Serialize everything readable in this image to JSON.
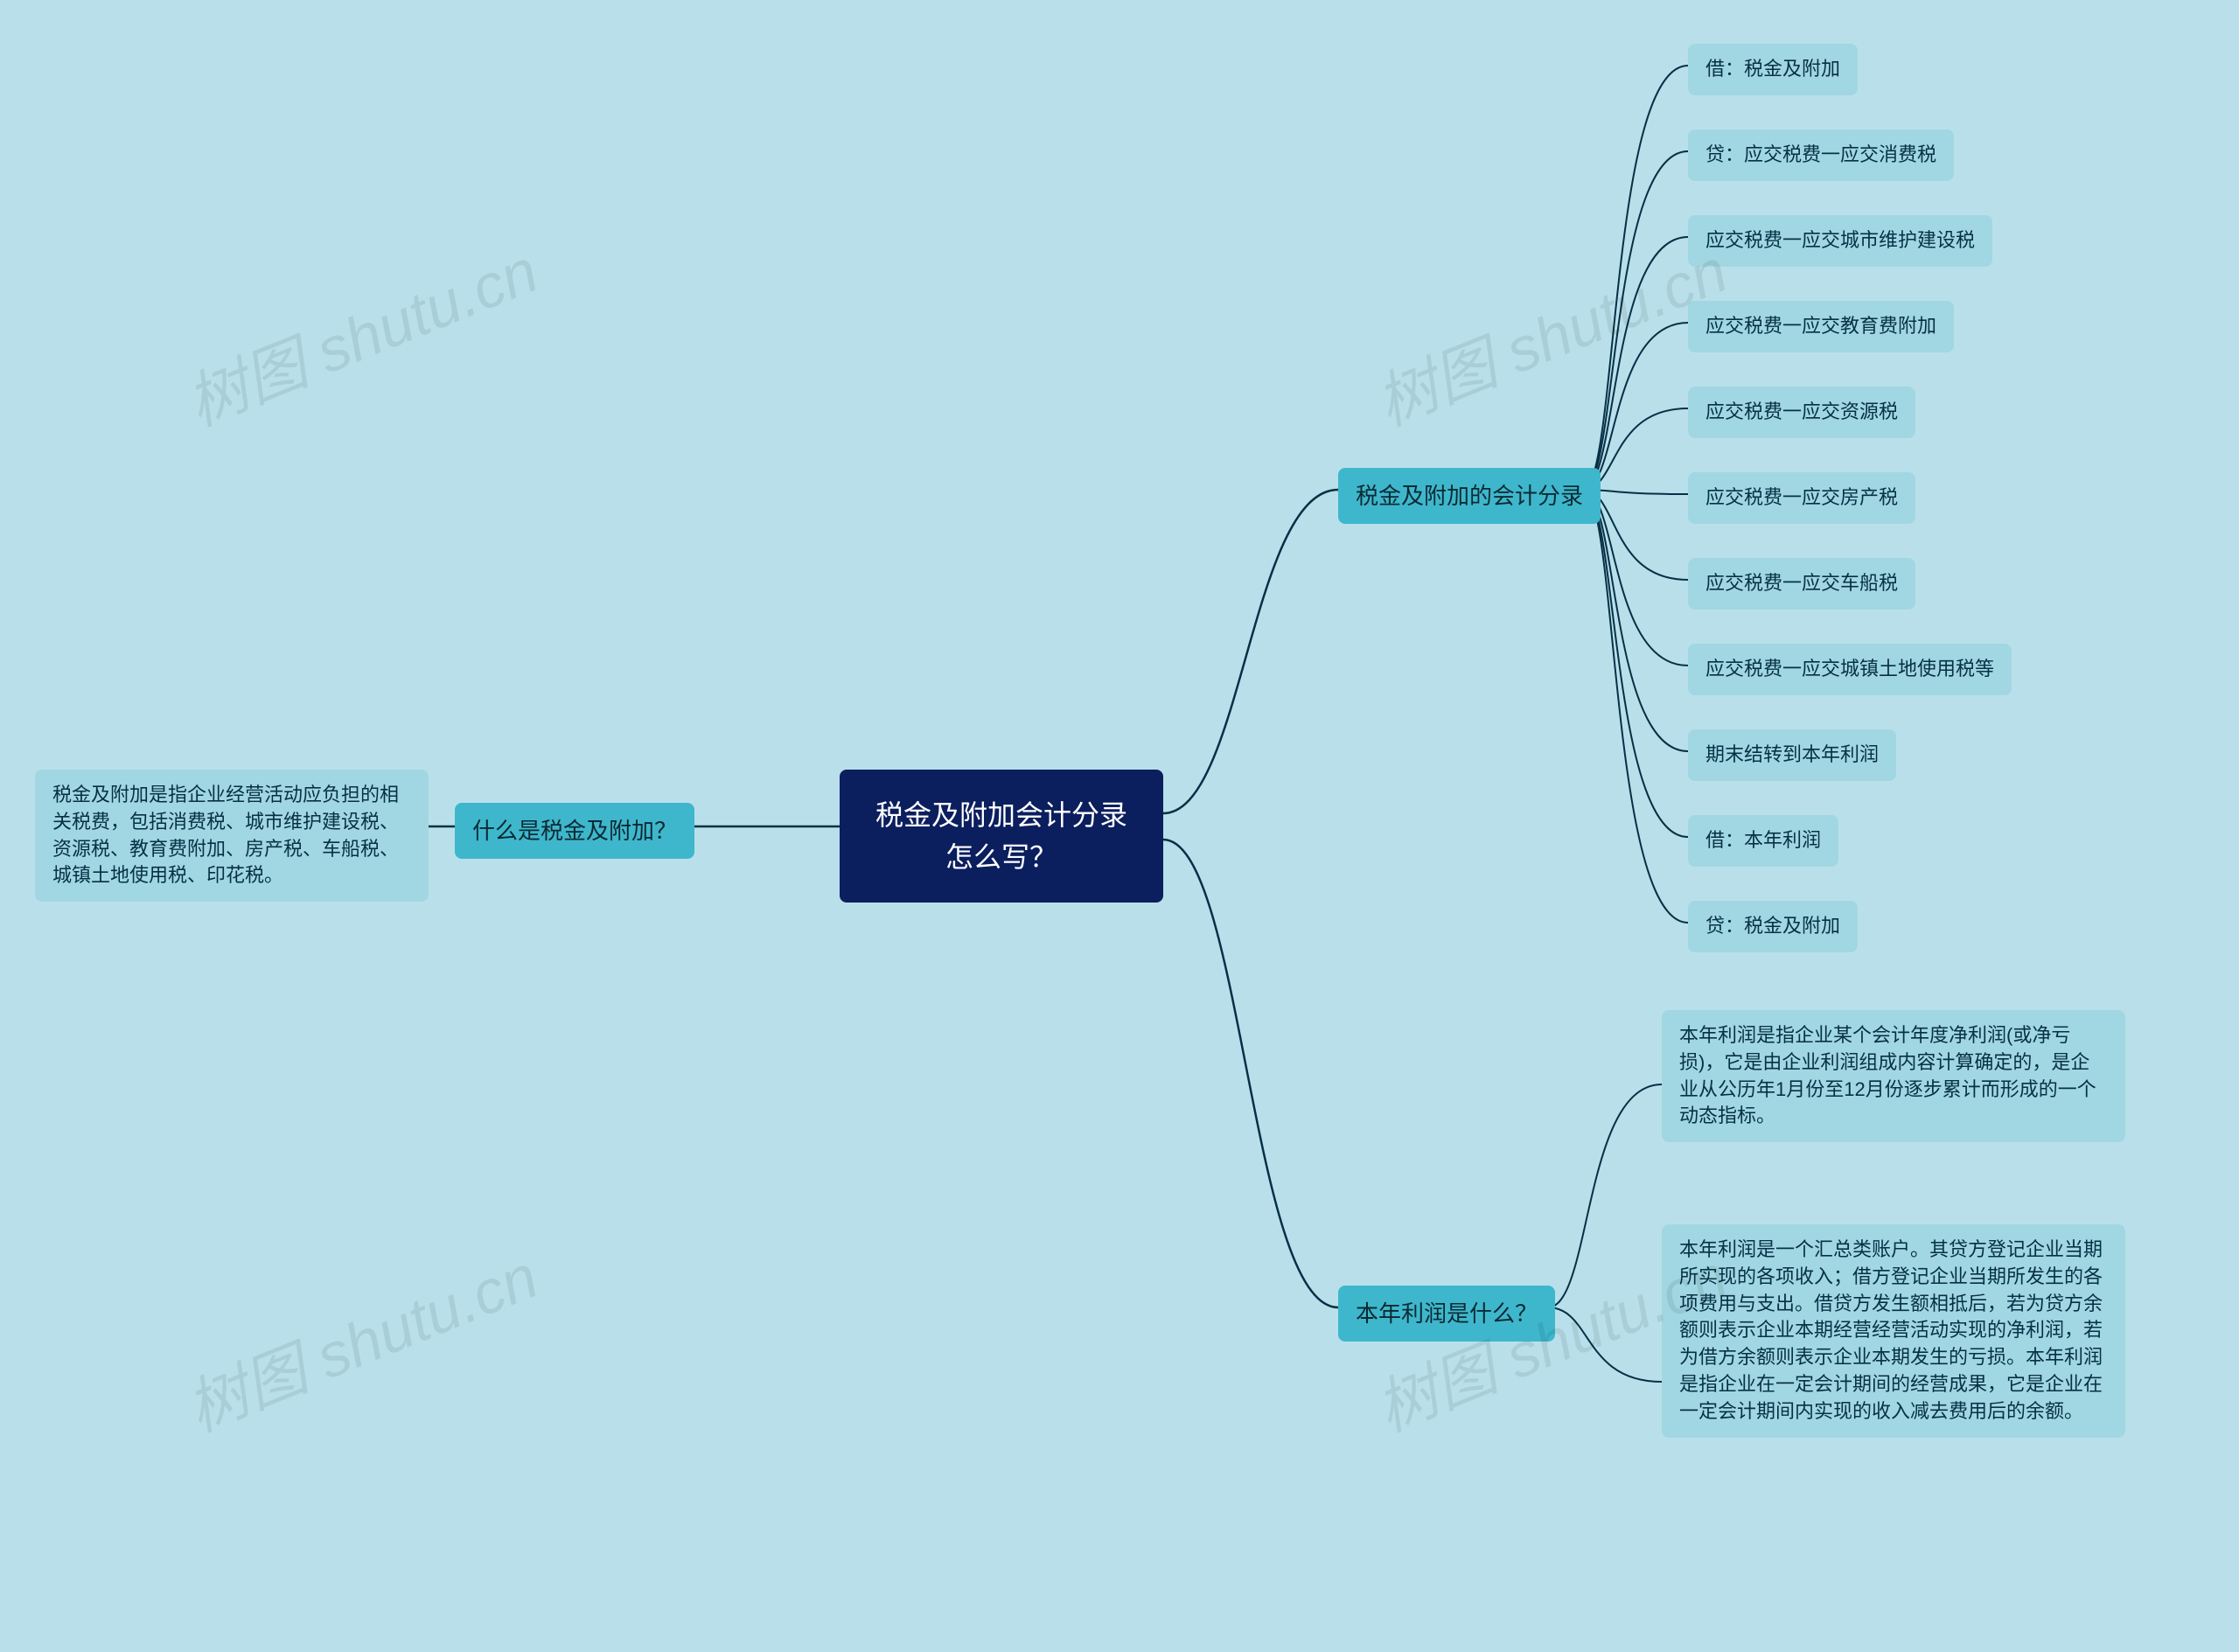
{
  "root": "税金及附加会计分录怎么写？",
  "left_branch": {
    "title": "什么是税金及附加？",
    "desc": "税金及附加是指企业经营活动应负担的相关税费，包括消费税、城市维护建设税、资源税、教育费附加、房产税、车船税、城镇土地使用税、印花税。"
  },
  "right_branch1": {
    "title": "税金及附加的会计分录",
    "items": [
      "借：税金及附加",
      "贷：应交税费一应交消费税",
      "应交税费一应交城市维护建设税",
      "应交税费一应交教育费附加",
      "应交税费一应交资源税",
      "应交税费一应交房产税",
      "应交税费一应交车船税",
      "应交税费一应交城镇土地使用税等",
      "期末结转到本年利润",
      "借：本年利润",
      "贷：税金及附加"
    ]
  },
  "right_branch2": {
    "title": "本年利润是什么？",
    "items": [
      "本年利润是指企业某个会计年度净利润(或净亏损)，它是由企业利润组成内容计算确定的，是企业从公历年1月份至12月份逐步累计而形成的一个动态指标。",
      "本年利润是一个汇总类账户。其贷方登记企业当期所实现的各项收入；借方登记企业当期所发生的各项费用与支出。借贷方发生额相抵后，若为贷方余额则表示企业本期经营经营活动实现的净利润，若为借方余额则表示企业本期发生的亏损。本年利润是指企业在一定会计期间的经营成果，它是企业在一定会计期间内实现的收入减去费用后的余额。"
    ]
  },
  "watermark": "树图 shutu.cn"
}
